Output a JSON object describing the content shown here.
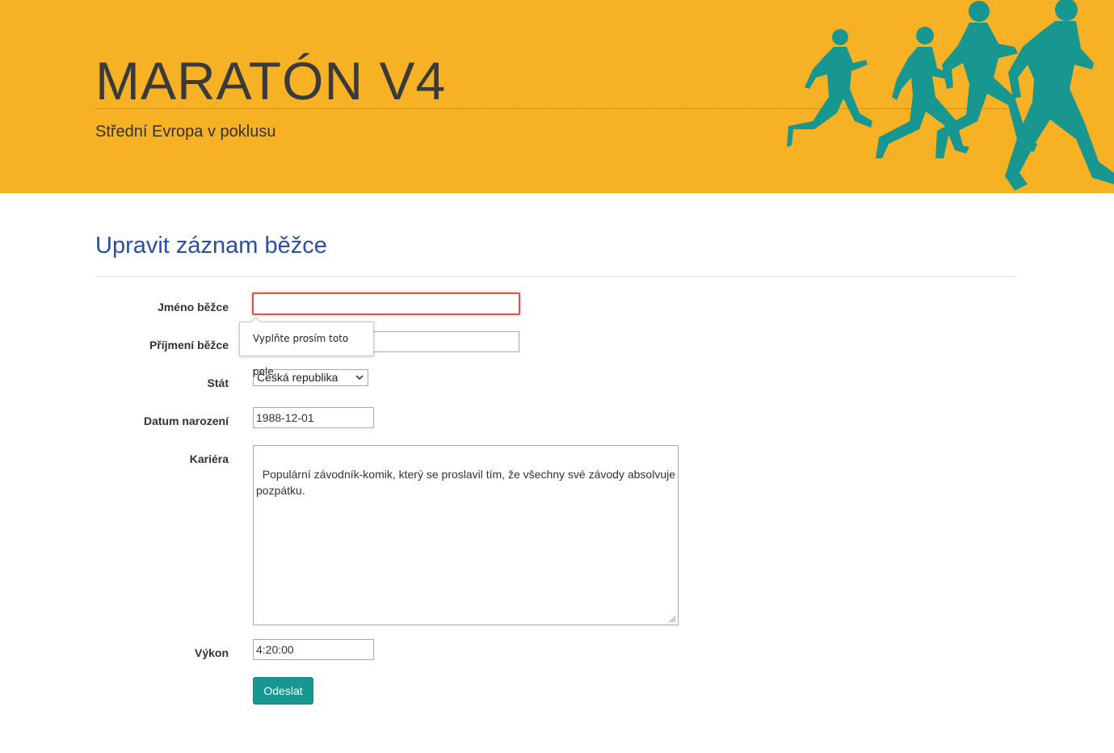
{
  "header": {
    "title": "MARATÓN V4",
    "subtitle": "Střední Evropa v poklusu",
    "colors": {
      "background": "#f7b124",
      "runners": "#17978f"
    },
    "decoration_icon": "running-people-silhouette"
  },
  "form": {
    "heading": "Upravit záznam běžce",
    "fields": {
      "first_name": {
        "label": "Jméno běžce",
        "value": ""
      },
      "last_name": {
        "label": "Příjmení běžce",
        "value": ""
      },
      "country": {
        "label": "Stát",
        "selected": "Česká republika"
      },
      "birth_date": {
        "label": "Datum narození",
        "value": "1988-12-01"
      },
      "career": {
        "label": "Kariéra",
        "value": "Populární závodník-komik, který se proslavil tím, že všechny své závody absolvuje\npozpátku."
      },
      "performance": {
        "label": "Výkon",
        "value": "4:20:00"
      }
    },
    "submit_label": "Odeslat",
    "validation_tooltip": "Vyplňte prosím toto pole."
  }
}
